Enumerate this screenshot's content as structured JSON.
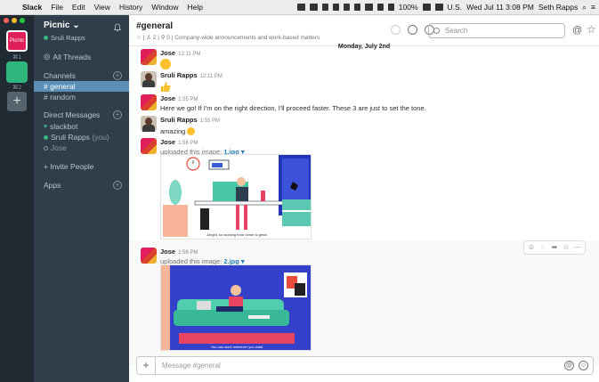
{
  "menubar": {
    "app": "Slack",
    "items": [
      "File",
      "Edit",
      "View",
      "History",
      "Window",
      "Help"
    ],
    "battery": "100%",
    "input_source": "U.S.",
    "clock": "Wed Jul 11  3:08 PM",
    "user": "Seth Rapps"
  },
  "team_switcher": {
    "teams": [
      {
        "label": "Picnic",
        "shortcut": "⌘1",
        "color": "#e01e5a"
      },
      {
        "label": "",
        "shortcut": "⌘2",
        "color": "#2eb67d"
      }
    ],
    "add": "+"
  },
  "sidebar": {
    "workspace": "Picnic",
    "user": "Sruli Rapps",
    "all_threads": "All Threads",
    "channels_header": "Channels",
    "channels": [
      "# general",
      "# random"
    ],
    "dm_header": "Direct Messages",
    "dms": [
      "slackbot",
      "Sruli Rapps",
      "Jose"
    ],
    "you_tag": "(you)",
    "invite": "+ Invite People",
    "apps": "Apps"
  },
  "channel": {
    "name": "#general",
    "members": "2",
    "pins": "0",
    "topic": "Company-wide announcements and work-based matters",
    "search_placeholder": "Search"
  },
  "day_divider": "Monday, July 2nd",
  "messages": [
    {
      "author": "Jose",
      "time": "12:11 PM",
      "text": ""
    },
    {
      "author": "Sruli Rapps",
      "time": "12:11 PM",
      "text": ""
    },
    {
      "author": "Jose",
      "time": "1:55 PM",
      "text": "Here we go! If I'm on the right direction, I'll proceed faster. These 3 are just to set the tone."
    },
    {
      "author": "Sruli Rapps",
      "time": "1:55 PM",
      "text": "amazing"
    },
    {
      "author": "Jose",
      "time": "1:56 PM",
      "text": "uploaded this image:",
      "file": "1.jpg",
      "caption": "Alright, so working from home is great"
    },
    {
      "author": "Jose",
      "time": "1:56 PM",
      "text": "uploaded this image:",
      "file": "2.jpg",
      "caption": "You can work wherever you want"
    }
  ],
  "composer": {
    "placeholder": "Message #general"
  },
  "colors": {
    "sidebar": "#2f3e4a",
    "teams": "#1f2a33",
    "active_channel": "#5a8fb8",
    "link": "#2a80b9",
    "presence": "#38b47c"
  }
}
